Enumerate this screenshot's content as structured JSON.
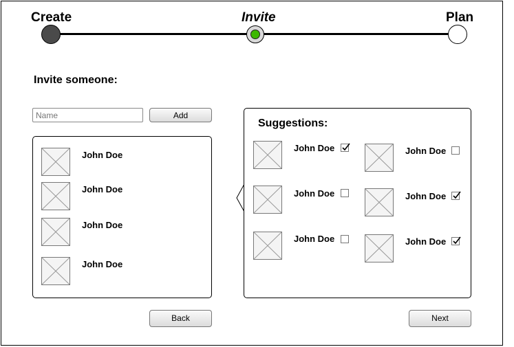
{
  "stepper": {
    "steps": [
      {
        "label": "Create",
        "state": "done"
      },
      {
        "label": "Invite",
        "state": "current"
      },
      {
        "label": "Plan",
        "state": "pending"
      }
    ]
  },
  "invite": {
    "heading": "Invite someone:",
    "name_placeholder": "Name",
    "add_label": "Add",
    "invitees": [
      {
        "name": "John Doe"
      },
      {
        "name": "John Doe"
      },
      {
        "name": "John Doe"
      },
      {
        "name": "John Doe"
      }
    ]
  },
  "suggestions": {
    "heading": "Suggestions:",
    "people": [
      {
        "name": "John Doe",
        "checked": true
      },
      {
        "name": "John Doe",
        "checked": false
      },
      {
        "name": "John Doe",
        "checked": false
      },
      {
        "name": "John Doe",
        "checked": false
      },
      {
        "name": "John Doe",
        "checked": true
      },
      {
        "name": "John Doe",
        "checked": true
      }
    ]
  },
  "footer": {
    "back_label": "Back",
    "next_label": "Next"
  },
  "colors": {
    "done_step": "#4a4a4a",
    "current_step_ring": "#d9d9d9",
    "current_step_dot": "#3cb800",
    "pending_step": "#ffffff"
  }
}
